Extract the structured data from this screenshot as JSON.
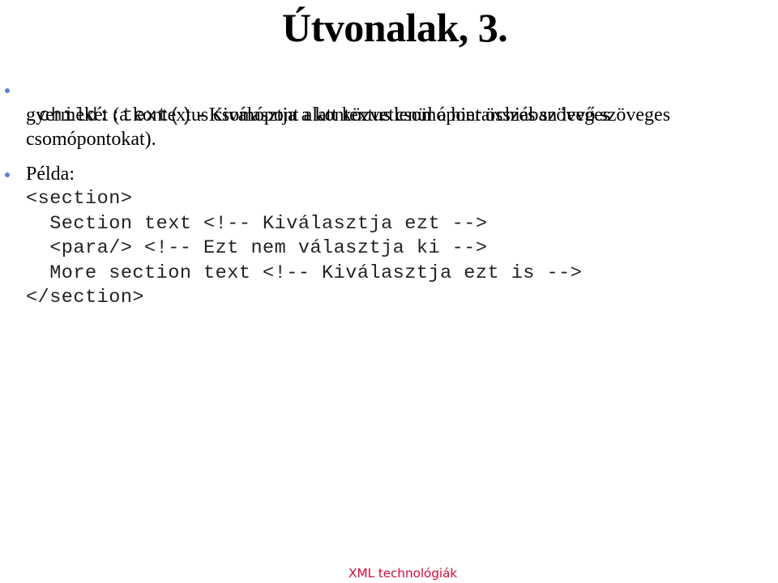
{
  "slide": {
    "title": "Útvonalak, 3.",
    "bullet1": {
      "code": "child::text()",
      "line1_rest": " - Kiválasztja a kontextus csomópont összes szöveges",
      "line2": "gyermekét (a kontextus csomópont alatt közvetlenül a hierarchiában levő szöveges",
      "line3": "csomópontokat)."
    },
    "bullet2": {
      "label": "Példa:",
      "code_lines": [
        "<section>",
        "  Section text <!-- Kiválasztja ezt -->",
        "  <para/> <!-- Ezt nem választja ki -->",
        "  More section text <!-- Kiválasztja ezt is -->",
        "</section>"
      ]
    },
    "footer": "XML technológiák"
  },
  "colors": {
    "bullet": "#5b7fd8",
    "footer": "#d0103a",
    "code_text": "#222222"
  }
}
